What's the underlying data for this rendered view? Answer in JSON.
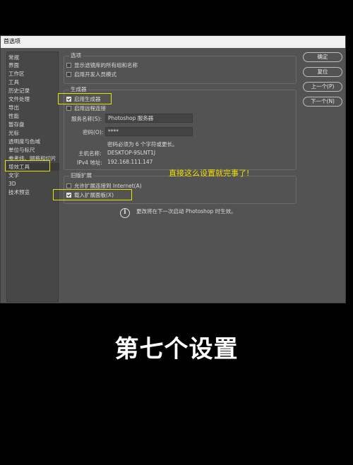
{
  "window": {
    "title": "首选项"
  },
  "sidebar": {
    "items": [
      {
        "label": "常规"
      },
      {
        "label": "界面"
      },
      {
        "label": "工作区"
      },
      {
        "label": "工具"
      },
      {
        "label": "历史记录"
      },
      {
        "label": "文件处理"
      },
      {
        "label": "导出"
      },
      {
        "label": "性能"
      },
      {
        "label": "暂存盘"
      },
      {
        "label": "光标"
      },
      {
        "label": "透明度与色域"
      },
      {
        "label": "单位与标尺"
      },
      {
        "label": "参考线、网格和切片"
      },
      {
        "label": "增效工具"
      },
      {
        "label": "文字"
      },
      {
        "label": "3D"
      },
      {
        "label": "技术预览"
      }
    ],
    "selected": "增效工具"
  },
  "options": {
    "legend": "选项",
    "show_filter_gallery": {
      "label": "显示滤镜库的所有组和名称",
      "checked": false
    },
    "enable_developer_mode": {
      "label": "启用开发人员模式",
      "checked": false
    }
  },
  "generator": {
    "legend": "生成器",
    "enable_generator": {
      "label": "启用生成器",
      "checked": true
    },
    "enable_remote": {
      "label": "启用远程连接",
      "checked": false
    },
    "service_name_label": "服务名称(S):",
    "service_name_value": "Photoshop 服务器",
    "password_label": "密码(O):",
    "password_value": "****",
    "password_hint": "密码必须为 6 个字符或更长。",
    "hostname_label": "主机名称:",
    "hostname_value": "DESKTOP-9SLNT1J",
    "ipv4_label": "IPv4 地址:",
    "ipv4_value": "192.168.111.147"
  },
  "legacy": {
    "legend": "旧版扩展",
    "allow_connect_internet": {
      "label": "允许扩展连接到 Internet(A)",
      "checked": false
    },
    "load_extension_panels": {
      "label": "载入扩展面板(X)",
      "checked": true
    }
  },
  "info_message": "更改将在下一次启动 Photoshop 时生效。",
  "buttons": {
    "ok": "确定",
    "reset": "复位",
    "prev": "上一个(P)",
    "next": "下一个(N)"
  },
  "annotation": "直接这么设置就完事了!",
  "caption": "第七个设置",
  "colors": {
    "highlight": "#e6e200",
    "dialog_bg": "#535353",
    "annotation": "#f0e000"
  }
}
